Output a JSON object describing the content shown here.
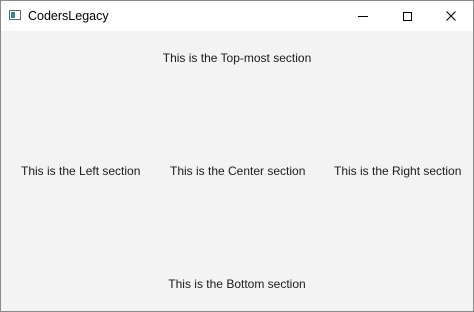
{
  "window": {
    "title": "CodersLegacy",
    "controls": {
      "minimize_icon": "minimize-icon",
      "maximize_icon": "maximize-icon",
      "close_icon": "close-icon",
      "close_glyph": "✕"
    }
  },
  "sections": {
    "top": "This is the Top-most section",
    "left": "This is the Left section",
    "center": "This is the Center section",
    "right": "This is the Right section",
    "bottom": "This is the Bottom section"
  },
  "colors": {
    "client_background": "#f3f3f3",
    "titlebar_background": "#ffffff"
  }
}
